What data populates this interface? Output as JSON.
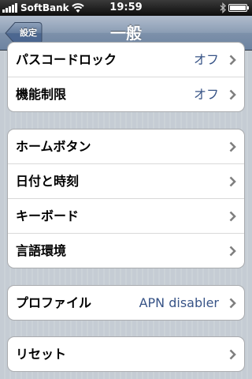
{
  "status_bar": {
    "carrier": "SoftBank",
    "time": "19:59",
    "signal_icon": "signal-bars-icon",
    "wifi_icon": "wifi-icon",
    "bluetooth_icon": "bluetooth-icon",
    "battery_icon": "battery-icon",
    "battery_level": 1.0
  },
  "nav": {
    "back_label": "設定",
    "title": "一般"
  },
  "groups": [
    {
      "rows": [
        {
          "label": "パスコードロック",
          "value": "オフ"
        },
        {
          "label": "機能制限",
          "value": "オフ"
        }
      ]
    },
    {
      "rows": [
        {
          "label": "ホームボタン"
        },
        {
          "label": "日付と時刻"
        },
        {
          "label": "キーボード"
        },
        {
          "label": "言語環境"
        }
      ]
    },
    {
      "rows": [
        {
          "label": "プロファイル",
          "value": "APN disabler"
        }
      ]
    },
    {
      "rows": [
        {
          "label": "リセット"
        }
      ]
    }
  ],
  "colors": {
    "nav_bar": "#7d91aa",
    "detail_text": "#385487",
    "background": "#c5ccd4"
  }
}
